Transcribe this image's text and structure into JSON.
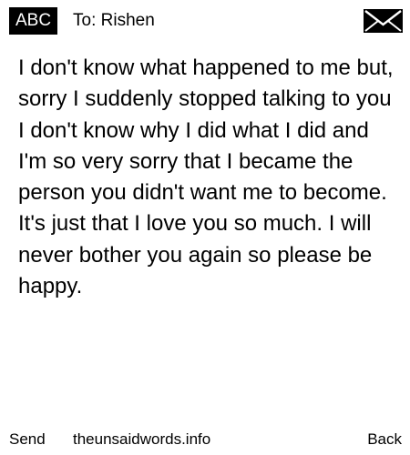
{
  "header": {
    "input_mode": "ABC",
    "recipient": "To: Rishen",
    "icon": "envelope-icon"
  },
  "message": {
    "body": "I don't know what happened to me but, sorry I suddenly stopped talking to you I don't know why I did what I did and I'm so very sorry that I became the person you didn't want me to become. It's just that I love you so much. I will never bother you again so please be happy."
  },
  "footer": {
    "left_softkey": "Send",
    "center_text": "theunsaidwords.info",
    "right_softkey": "Back"
  },
  "colors": {
    "background": "#ffffff",
    "text": "#000000",
    "badge_background": "#000000",
    "badge_text": "#ffffff"
  }
}
